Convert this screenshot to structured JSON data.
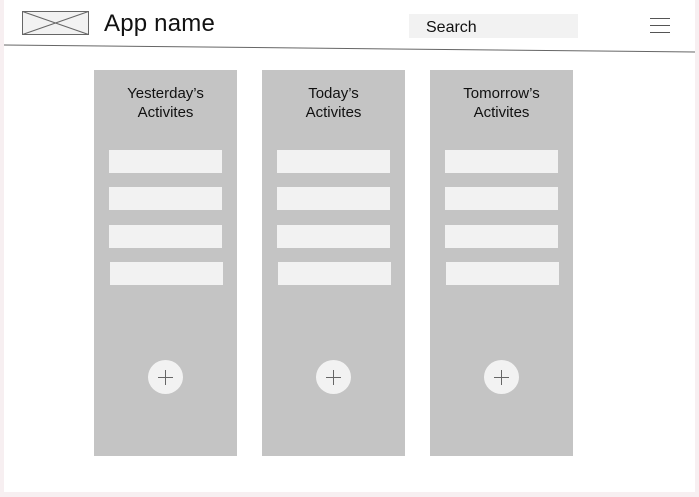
{
  "header": {
    "app_name": "App name",
    "logo_icon": "image-placeholder-icon",
    "search_placeholder": "Search",
    "menu_icon": "hamburger-menu-icon"
  },
  "columns": [
    {
      "title": "Yesterday’s\nActivites",
      "task_count": 4,
      "add_icon": "plus-icon"
    },
    {
      "title": "Today’s\nActivites",
      "task_count": 4,
      "add_icon": "plus-icon"
    },
    {
      "title": "Tomorrow’s\nActivites",
      "task_count": 4,
      "add_icon": "plus-icon"
    }
  ],
  "colors": {
    "column_bg": "#c4c4c4",
    "item_bg": "#f2f2f2",
    "page_bg": "#ffffff",
    "outer_bg": "#f7eff1"
  }
}
